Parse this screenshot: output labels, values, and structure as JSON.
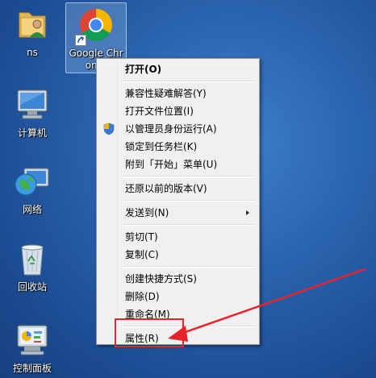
{
  "desktop": {
    "icons": [
      {
        "id": "ns",
        "label": "ns"
      },
      {
        "id": "chrome",
        "label": "Google Chrome"
      },
      {
        "id": "computer",
        "label": "计算机"
      },
      {
        "id": "network",
        "label": "网络"
      },
      {
        "id": "recycle",
        "label": "回收站"
      },
      {
        "id": "control",
        "label": "控制面板"
      }
    ]
  },
  "context_menu": {
    "items": [
      {
        "label": "打开(O)"
      },
      {
        "label": "兼容性疑难解答(Y)"
      },
      {
        "label": "打开文件位置(I)"
      },
      {
        "label": "以管理员身份运行(A)",
        "icon": "uac-shield-icon"
      },
      {
        "label": "锁定到任务栏(K)"
      },
      {
        "label": "附到「开始」菜单(U)"
      },
      {
        "label": "还原以前的版本(V)"
      },
      {
        "label": "发送到(N)"
      },
      {
        "label": "剪切(T)"
      },
      {
        "label": "复制(C)"
      },
      {
        "label": "创建快捷方式(S)"
      },
      {
        "label": "删除(D)"
      },
      {
        "label": "重命名(M)"
      },
      {
        "label": "属性(R)"
      }
    ]
  },
  "colors": {
    "annotation": "#e8232a",
    "menu_bg": "#f0f0f0"
  }
}
